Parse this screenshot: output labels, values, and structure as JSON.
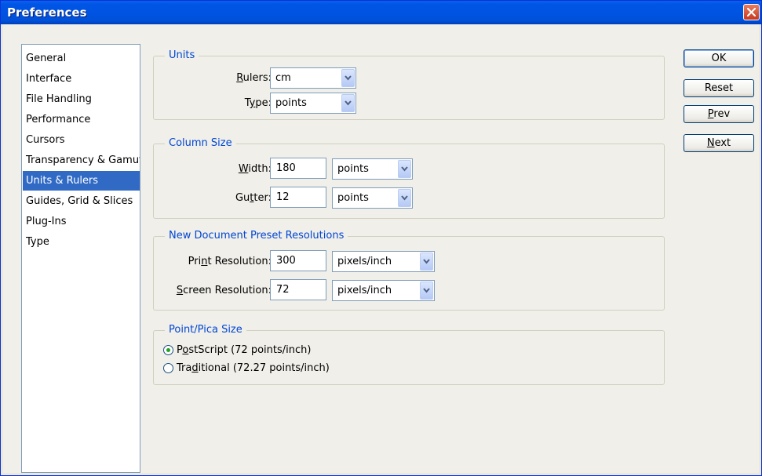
{
  "window": {
    "title": "Preferences"
  },
  "categories": [
    {
      "label": "General",
      "selected": false
    },
    {
      "label": "Interface",
      "selected": false
    },
    {
      "label": "File Handling",
      "selected": false
    },
    {
      "label": "Performance",
      "selected": false
    },
    {
      "label": "Cursors",
      "selected": false
    },
    {
      "label": "Transparency & Gamut",
      "selected": false
    },
    {
      "label": "Units & Rulers",
      "selected": true
    },
    {
      "label": "Guides, Grid & Slices",
      "selected": false
    },
    {
      "label": "Plug-Ins",
      "selected": false
    },
    {
      "label": "Type",
      "selected": false
    }
  ],
  "units": {
    "legend": "Units",
    "rulers_label_pre": "",
    "rulers_label_ul": "R",
    "rulers_label_post": "ulers:",
    "rulers_value": "cm",
    "type_label_pre": "T",
    "type_label_ul": "y",
    "type_label_post": "pe:",
    "type_value": "points"
  },
  "column_size": {
    "legend": "Column Size",
    "width_label_pre": "",
    "width_label_ul": "W",
    "width_label_post": "idth:",
    "width_value": "180",
    "width_unit": "points",
    "gutter_label_pre": "Gu",
    "gutter_label_ul": "t",
    "gutter_label_post": "ter:",
    "gutter_value": "12",
    "gutter_unit": "points"
  },
  "presets": {
    "legend": "New Document Preset Resolutions",
    "print_label_pre": "Pri",
    "print_label_ul": "n",
    "print_label_post": "t Resolution:",
    "print_value": "300",
    "print_unit": "pixels/inch",
    "screen_label_pre": "",
    "screen_label_ul": "S",
    "screen_label_post": "creen Resolution:",
    "screen_value": "72",
    "screen_unit": "pixels/inch"
  },
  "pica": {
    "legend": "Point/Pica Size",
    "postscript_pre": "P",
    "postscript_ul": "o",
    "postscript_post": "stScript (72 points/inch)",
    "postscript_selected": true,
    "traditional_pre": "Tra",
    "traditional_ul": "d",
    "traditional_post": "itional (72.27 points/inch)",
    "traditional_selected": false
  },
  "buttons": {
    "ok": "OK",
    "reset": "Reset",
    "prev_ul": "P",
    "prev_post": "rev",
    "next_ul": "N",
    "next_post": "ext"
  },
  "colors": {
    "titlebar": "#0054e3",
    "selection": "#316ac5",
    "legend_text": "#0046d5"
  }
}
